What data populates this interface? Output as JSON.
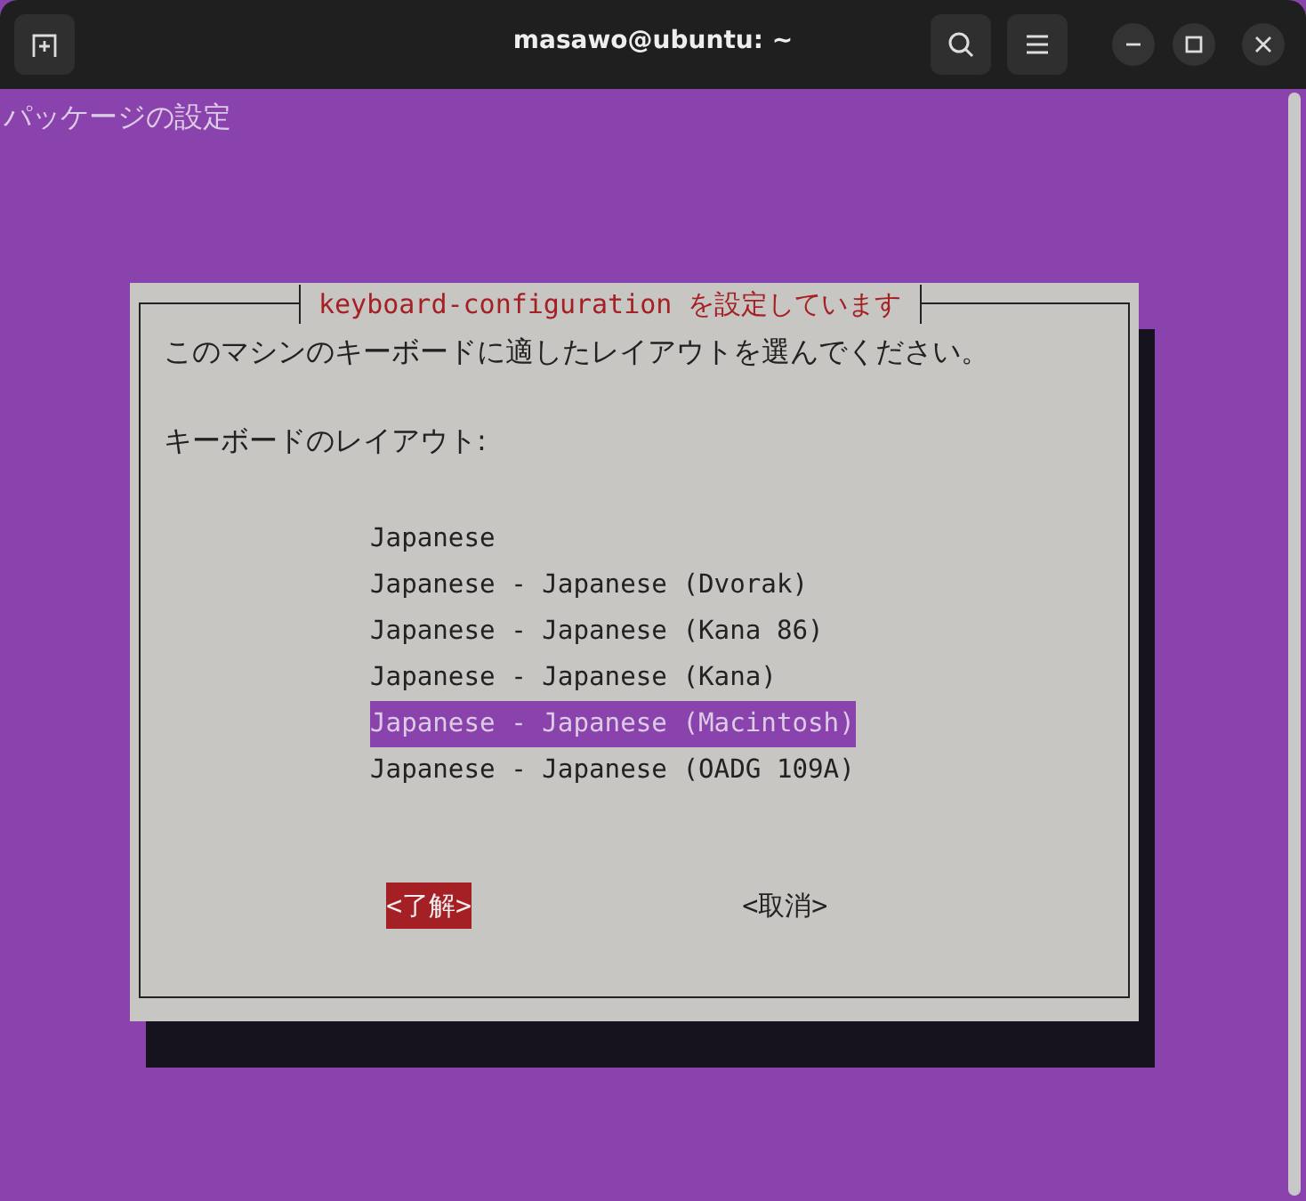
{
  "window": {
    "title": "masawo@ubuntu: ~"
  },
  "terminal": {
    "header": "パッケージの設定"
  },
  "dialog": {
    "title": "keyboard-configuration を設定しています",
    "prompt": "このマシンのキーボードに適したレイアウトを選んでください。",
    "label": "キーボードのレイアウト:",
    "options": [
      {
        "label": "Japanese",
        "selected": false
      },
      {
        "label": "Japanese - Japanese (Dvorak)",
        "selected": false
      },
      {
        "label": "Japanese - Japanese (Kana 86)",
        "selected": false
      },
      {
        "label": "Japanese - Japanese (Kana)",
        "selected": false
      },
      {
        "label": "Japanese - Japanese (Macintosh)",
        "selected": true
      },
      {
        "label": "Japanese - Japanese (OADG 109A)",
        "selected": false
      }
    ],
    "buttons": [
      {
        "label": "<了解>",
        "selected": true
      },
      {
        "label": "<取消>",
        "selected": false
      }
    ]
  }
}
